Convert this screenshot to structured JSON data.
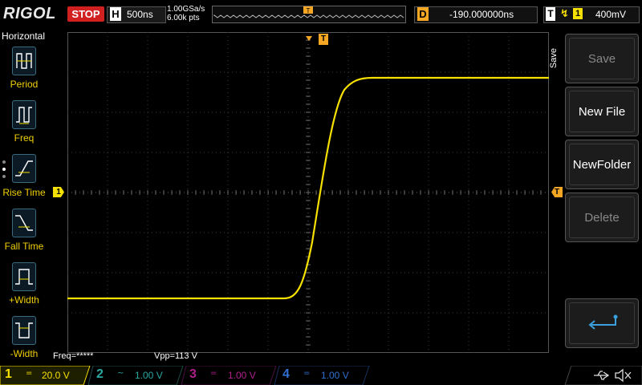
{
  "header": {
    "brand": "RIGOL",
    "run_state": "STOP",
    "timebase_letter": "H",
    "timebase": "500ns",
    "sample_rate": "1.00GSa/s",
    "memory_depth": "6.00k pts",
    "delay_letter": "D",
    "delay": "-190.000000ns",
    "trigger_letter": "T",
    "trigger_edge": "↯",
    "trigger_channel": "1",
    "trigger_level": "400mV"
  },
  "left_menu": {
    "title": "Horizontal",
    "items": [
      {
        "label": "Period",
        "icon": "period-icon"
      },
      {
        "label": "Freq",
        "icon": "freq-icon"
      },
      {
        "label": "Rise Time",
        "icon": "rise-time-icon"
      },
      {
        "label": "Fall Time",
        "icon": "fall-time-icon"
      },
      {
        "label": "+Width",
        "icon": "positive-width-icon"
      },
      {
        "label": "-Width",
        "icon": "negative-width-icon"
      }
    ]
  },
  "right_menu": {
    "tab_label": "Save",
    "buttons": [
      {
        "label": "Save",
        "enabled": false
      },
      {
        "label": "New File",
        "enabled": true
      },
      {
        "label": "NewFolder",
        "enabled": true
      },
      {
        "label": "Delete",
        "enabled": false
      },
      {
        "label": "",
        "icon": "enter-return-icon",
        "enabled": true
      }
    ]
  },
  "measurements": {
    "freq": "Freq=*****",
    "vpp": "Vpp=113 V"
  },
  "channels": [
    {
      "num": "1",
      "coupling": "=",
      "scale": "20.0 V",
      "color": "#f5e000",
      "active": true
    },
    {
      "num": "2",
      "coupling": "~",
      "scale": "1.00 V",
      "color": "#2aa8a0",
      "active": false
    },
    {
      "num": "3",
      "coupling": "=",
      "scale": "1.00 V",
      "color": "#b0208a",
      "active": false
    },
    {
      "num": "4",
      "coupling": "=",
      "scale": "1.00 V",
      "color": "#3070d0",
      "active": false
    }
  ],
  "colors": {
    "trace": "#f5e000",
    "accent": "#f5a623",
    "stop": "#d02020",
    "grid": "#3a3a3a"
  }
}
